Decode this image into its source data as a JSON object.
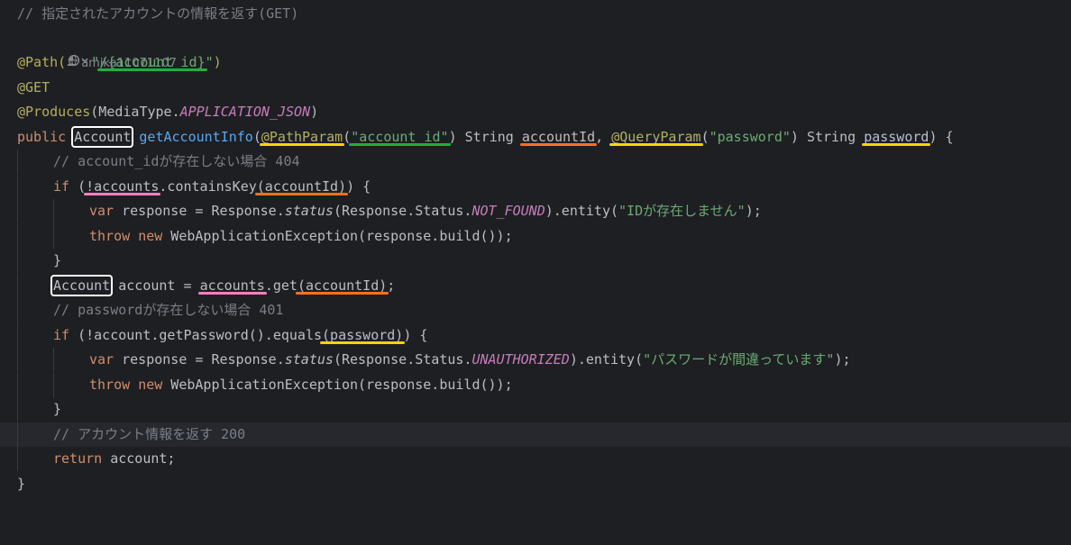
{
  "code": {
    "l1_comment": "// 指定されたアカウントの情報を返す(GET)",
    "l2_author": "amika11071107",
    "l3_ann": "@Path(",
    "l3_str_q1": "\"",
    "l3_str_path": "/{account_id}",
    "l3_str_q2": "\"",
    "l3_close": ")",
    "l4_ann": "@GET",
    "l5_ann": "@Produces",
    "l5_open": "(MediaType.",
    "l5_const": "APPLICATION_JSON",
    "l5_close": ")",
    "l6_kw": "public",
    "l6_type": "Account",
    "l6_fn": "getAccountInfo",
    "l6_open": "(",
    "l6_ann1": "@PathParam",
    "l6_p1open": "(",
    "l6_str1": "\"account_id\"",
    "l6_p1close": ") String ",
    "l6_param1": "accountId",
    "l6_comma": ", ",
    "l6_ann2": "@QueryParam",
    "l6_p2open": "(",
    "l6_str2": "\"password\"",
    "l6_p2close": ") String ",
    "l6_param2": "password",
    "l6_end": ") {",
    "l7_comment": "// account_idが存在しない場合 404",
    "l8_kw": "if",
    "l8_a": " (",
    "l8_ul": "!accounts",
    "l8_b": ".containsKey",
    "l8_c": "(accountId)",
    "l8_d": ") {",
    "l9_kw": "var",
    "l9_a": " response = Response.",
    "l9_fn": "status",
    "l9_b": "(Response.Status.",
    "l9_const": "NOT_FOUND",
    "l9_c": ").entity(",
    "l9_str": "\"IDが存在しません\"",
    "l9_d": ");",
    "l10_kw1": "throw",
    "l10_kw2": "new",
    "l10_rest": " WebApplicationException(response.build());",
    "l11_brace": "}",
    "l12_type": "Account",
    "l12_a": " account = ",
    "l12_ul1": "accounts",
    "l12_b": ".get",
    "l12_ul2": "(accountId)",
    "l12_c": ";",
    "l13_comment": "// passwordが存在しない場合 401",
    "l14_kw": "if",
    "l14_a": " (!account.getPassword().equals",
    "l14_ul": "(password)",
    "l14_b": ") {",
    "l15_kw": "var",
    "l15_a": " response = Response.",
    "l15_fn": "status",
    "l15_b": "(Response.Status.",
    "l15_const": "UNAUTHORIZED",
    "l15_c": ").entity(",
    "l15_str": "\"パスワードが間違っています\"",
    "l15_d": ");",
    "l16_kw1": "throw",
    "l16_kw2": "new",
    "l16_rest": " WebApplicationException(response.build());",
    "l17_brace": "}",
    "l18_comment": "// アカウント情報を返す 200",
    "l19_kw": "return",
    "l19_rest": " account;",
    "l20_brace": "}"
  },
  "colors": {
    "background": "#1e1f22",
    "comment": "#7a7e85",
    "annotation": "#b3ae60",
    "keyword": "#cf8e6d",
    "string": "#6aab73",
    "function": "#56a8f5",
    "constant": "#c77dbb",
    "markup_box": "#ffffff",
    "underline_green": "#1eb03d",
    "underline_orange": "#ff6f24",
    "underline_yellow": "#ffd400",
    "underline_pink": "#ff7fc0"
  },
  "icons": {
    "author": "person-icon",
    "path_url": "globe-icon"
  }
}
